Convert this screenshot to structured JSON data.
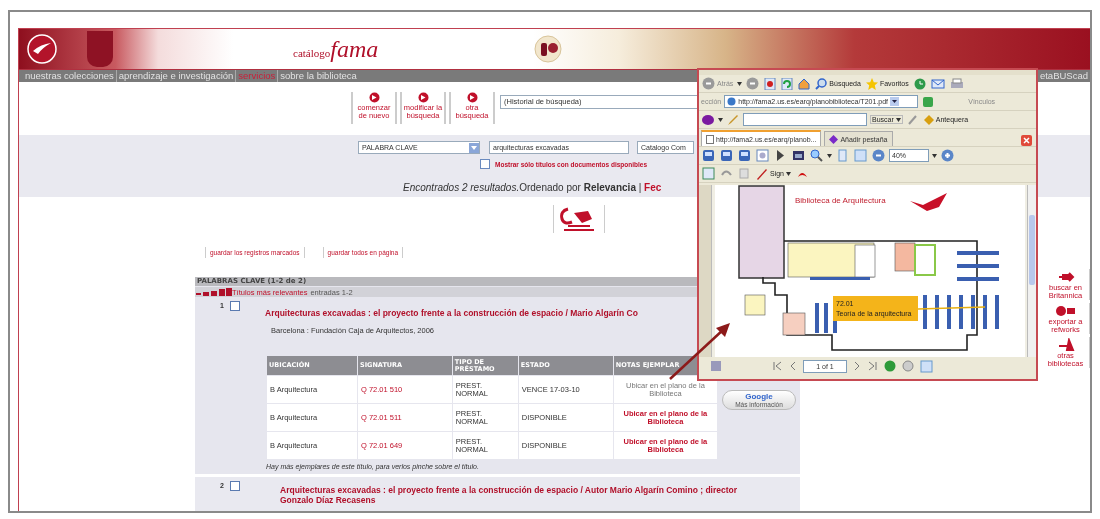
{
  "header": {
    "logo_small": "catálogo",
    "logo_big": "fama"
  },
  "nav": {
    "items": [
      {
        "label": "nuestras colecciones",
        "selected": false
      },
      {
        "label": "aprendizaje e investigación",
        "selected": false
      },
      {
        "label": "servicios",
        "selected": true
      },
      {
        "label": "sobre la biblioteca",
        "selected": false
      }
    ],
    "right_link": "etaBUScad"
  },
  "actions": [
    {
      "label": "comenzar de nuevo"
    },
    {
      "label": "modificar la búsqueda"
    },
    {
      "label": "otra búsqueda"
    }
  ],
  "history_select": {
    "value": "(Historial de búsqueda)"
  },
  "search": {
    "field_type": "PALABRA CLAVE",
    "query": "arquitecturas excavadas",
    "catalog": "Catalogo Com",
    "only_available": {
      "label": "Mostrar sólo títulos con documentos disponibles",
      "checked": false
    }
  },
  "summary": {
    "count_text": "Encontrados 2 resultados.",
    "order_text": "Ordenado por **Relevancia** | ",
    "sort_link": "Fec"
  },
  "save_buttons": [
    "guardar los registros marcados",
    "guardar todos en página"
  ],
  "results": {
    "heading": "PALABRAS CLAVE (1-2 de 2)",
    "group_label": "Títulos más relevantes",
    "group_range": "entradas 1-2",
    "columns": [
      "UBICACIÓN",
      "SIGNATURA",
      "TIPO DE PRÉSTAMO",
      "ESTADO",
      "NOTAS EJEMPLAR"
    ],
    "items": [
      {
        "number": "1",
        "checked": false,
        "title": "Arquitecturas excavadas : el proyecto frente a la construcción de espacio / Mario Algarín Co",
        "imprint": "Barcelona : Fundación Caja de Arquitectos, 2006",
        "copies": [
          {
            "location": "B Arquitectura",
            "call_number": "Q 72.01 510",
            "loan_type": "PREST. NORMAL",
            "status": "VENCE 17-03-10",
            "note": "Ubicar en el plano de la Biblioteca",
            "visited": true
          },
          {
            "location": "B Arquitectura",
            "call_number": "Q 72.01 511",
            "loan_type": "PREST. NORMAL",
            "status": "DISPONIBLE",
            "note": "Ubicar en el plano de la Biblioteca",
            "visited": false
          },
          {
            "location": "B Arquitectura",
            "call_number": "Q 72.01 649",
            "loan_type": "PREST. NORMAL",
            "status": "DISPONIBLE",
            "note": "Ubicar en el plano de la Biblioteca",
            "visited": false
          }
        ],
        "more_copies": "Hay más ejemplares de este título, para verlos pinche sobre el título."
      },
      {
        "number": "2",
        "checked": false,
        "title": "Arquitecturas excavadas : el proyecto frente a la construcción de espacio / Autor Mario Algarín Comino ; director Gonzalo Díaz Recasens"
      }
    ]
  },
  "google_button": {
    "brand": "Google",
    "label": "Más información"
  },
  "side_tools": [
    {
      "label": "buscar en Britannica"
    },
    {
      "label": "exportar a refworks"
    },
    {
      "label": "otras bibliotecas"
    }
  ],
  "pdf_window": {
    "back": "Atrás",
    "search": "Búsqueda",
    "favorites": "Favoritos",
    "address_label": "ección",
    "url": "http://fama2.us.es/earq/planobiblioteca/T201.pdf",
    "links_label": "Vínculos",
    "search_button": "Buscar",
    "bookmark": "Antequera",
    "tabs": [
      {
        "label": "http://fama2.us.es/earq/planob...",
        "selected": true
      },
      {
        "label": "Añadir pestaña",
        "selected": false
      }
    ],
    "zoom": "40%",
    "sign": "Sign",
    "page": "1 of 1",
    "plan": {
      "title": "Biblioteca de Arquitectura",
      "callout_code": "72.01",
      "callout_label": "Teoría de la arquitectura"
    }
  }
}
